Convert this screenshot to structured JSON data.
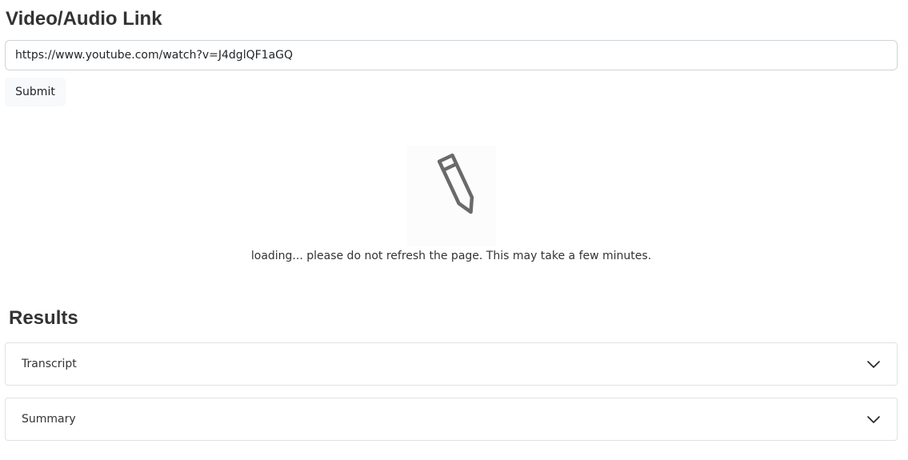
{
  "link_section": {
    "title": "Video/Audio Link",
    "url_value": "https://www.youtube.com/watch?v=J4dglQF1aGQ",
    "submit_label": "Submit"
  },
  "loading": {
    "icon": "pencil-icon",
    "message": "loading... please do not refresh the page. This may take a few minutes."
  },
  "results": {
    "title": "Results",
    "panels": [
      {
        "label": "Transcript",
        "icon": "chevron-down-icon"
      },
      {
        "label": "Summary",
        "icon": "chevron-down-icon"
      }
    ]
  }
}
